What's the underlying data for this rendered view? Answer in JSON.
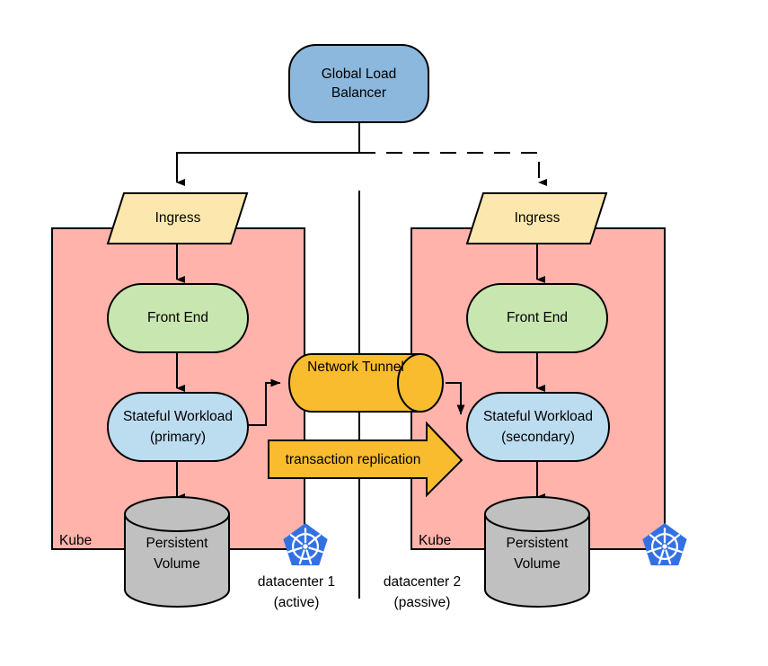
{
  "diagram": {
    "title": "Kubernetes multi-datacenter active/passive stateful workload topology",
    "colors": {
      "load_balancer_fill": "#8CB8DE",
      "ingress_fill": "#FCE8AE",
      "frontend_fill": "#C8E6AF",
      "workload_fill": "#BCDCF0",
      "volume_fill": "#C0C0C0",
      "zone_fill": "#FFB3AB",
      "tunnel_fill": "#F8BC2E",
      "replication_arrow_fill": "#F8BC2E",
      "kubernetes_logo": "#3371E3",
      "stroke": "#000000",
      "background": "#FFFFFF"
    },
    "load_balancer": {
      "label_line1": "Global Load",
      "label_line2": "Balancer"
    },
    "left": {
      "zone_label": "Kube",
      "ingress": "Ingress",
      "frontend": "Front End",
      "workload_line1": "Stateful Workload",
      "workload_line2": "(primary)",
      "volume_line1": "Persistent",
      "volume_line2": "Volume",
      "datacenter_line1": "datacenter 1",
      "datacenter_line2": "(active)"
    },
    "right": {
      "zone_label": "Kube",
      "ingress": "Ingress",
      "frontend": "Front End",
      "workload_line1": "Stateful Workload",
      "workload_line2": "(secondary)",
      "volume_line1": "Persistent",
      "volume_line2": "Volume",
      "datacenter_line1": "datacenter 2",
      "datacenter_line2": "(passive)"
    },
    "center": {
      "tunnel_label": "Network Tunnel",
      "replication_label": "transaction replication"
    },
    "icons": {
      "kubernetes_left": "kubernetes-logo-icon",
      "kubernetes_right": "kubernetes-logo-icon"
    }
  }
}
